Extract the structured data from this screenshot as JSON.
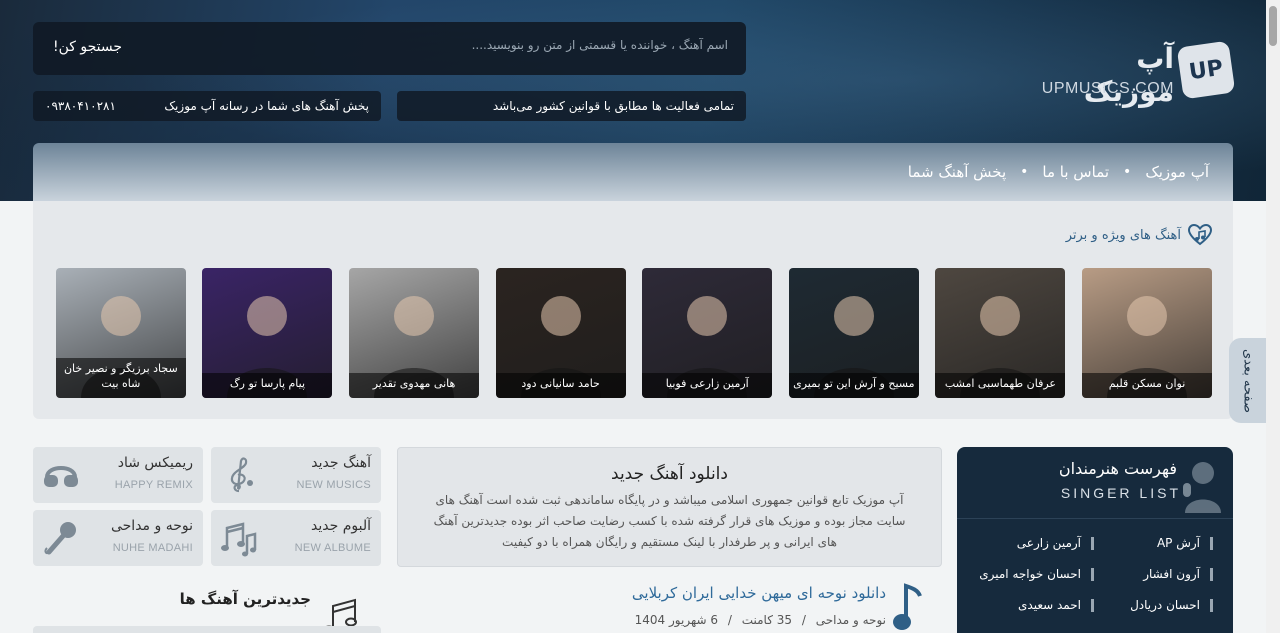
{
  "logo": {
    "fa": "آپ موزیک",
    "en": "UPMUSICS.COM",
    "badge": "UP"
  },
  "search": {
    "placeholder": "اسم آهنگ ، خواننده یا قسمتی از متن رو بنویسید....",
    "button": "جستجو کن!"
  },
  "notices": {
    "compliance": "تمامی فعالیت ها مطابق با قوانین کشور می‌باشد",
    "promo": "پخش آهنگ های شما در رسانه آپ موزیک",
    "phone": "۰۹۳۸۰۴۱۰۲۸۱"
  },
  "nav": [
    "آپ موزیک",
    "تماس با ما",
    "پخش آهنگ شما"
  ],
  "featured": {
    "title": "آهنگ های ویژه و برتر",
    "items": [
      {
        "caption": "نوان مسکن قلبم",
        "color": "#b89c85"
      },
      {
        "caption": "عرفان طهماسبی امشب",
        "color": "#4e4740"
      },
      {
        "caption": "مسیح و آرش این تو بمیری",
        "color": "#1e2a33"
      },
      {
        "caption": "آرمین زارعی فوبیا",
        "color": "#2e2a38"
      },
      {
        "caption": "حامد سانیانی دود",
        "color": "#2b2420"
      },
      {
        "caption": "هانی مهدوی تقدیر",
        "color": "#a6a6a6"
      },
      {
        "caption": "پیام پارسا تو رگ",
        "color": "#3a2466"
      },
      {
        "caption": "سجاد برزیگر و نصیر خان شاه بیت",
        "color": "#a9b0b7"
      }
    ]
  },
  "side_tab": "صفحه بعدی",
  "categories": [
    {
      "title": "آهنگ جدید",
      "sub": "NEW MUSICS",
      "icon": "treble-clef-icon"
    },
    {
      "title": "ریمیکس شاد",
      "sub": "HAPPY REMIX",
      "icon": "headphones-icon"
    },
    {
      "title": "آلبوم جدید",
      "sub": "NEW ALBUME",
      "icon": "music-notes-icon"
    },
    {
      "title": "نوحه و مداحی",
      "sub": "NUHE MADAHI",
      "icon": "microphone-icon"
    }
  ],
  "newest_title": "جدیدترین آهنگ ها",
  "intro": {
    "title": "دانلود آهنگ جدید",
    "text": "آپ موزیک تابع قوانین جمهوری اسلامی میباشد و در پایگاه ساماندهی ثبت شده است آهنگ های سایت مجاز بوده و موزیک های قرار گرفته شده با کسب رضایت صاحب اثر بوده جدیدترین آهنگ های ایرانی و پر طرفدار با لینک مستقیم و رایگان همراه با دو کیفیت"
  },
  "post": {
    "title": "دانلود نوحه ای میهن خدایی ایران کربلایی",
    "category": "نوحه و مداحی",
    "comments": "35 کامنت",
    "date": "6 شهریور 1404",
    "sep": "/"
  },
  "singers": {
    "title": "فهرست هنرمندان",
    "sub": "SINGER LIST",
    "items": [
      "آرش AP",
      "آرمین زارعی",
      "آرون افشار",
      "احسان خواجه امیری",
      "احسان دریادل",
      "احمد سعیدی"
    ]
  }
}
